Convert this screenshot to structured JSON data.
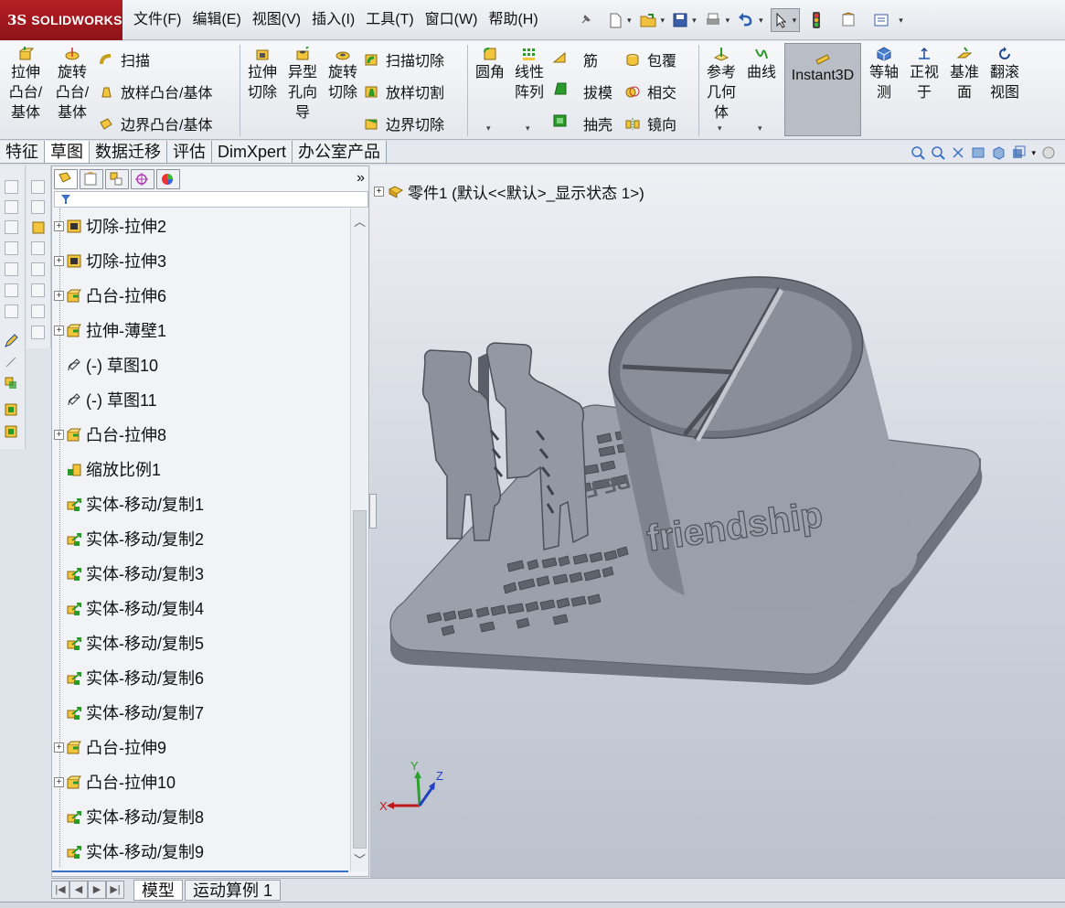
{
  "app": {
    "logo_mark": "3S",
    "logo_text": "SOLIDWORKS"
  },
  "menu": [
    "文件(F)",
    "编辑(E)",
    "视图(V)",
    "插入(I)",
    "工具(T)",
    "窗口(W)",
    "帮助(H)"
  ],
  "toolbar": {
    "extrude_boss": "拉伸\n凸台/\n基体",
    "revolve_boss": "旋转\n凸台/\n基体",
    "sweep": "扫描",
    "loft_boss": "放样凸台/基体",
    "boundary_boss": "边界凸台/基体",
    "extrude_cut": "拉伸\n切除",
    "hole_wizard": "异型\n孔向\n导",
    "revolve_cut": "旋转\n切除",
    "swept_cut": "扫描切除",
    "lofted_cut": "放样切割",
    "boundary_cut": "边界切除",
    "fillet": "圆角",
    "linear_pattern": "线性\n阵列",
    "rib": "筋",
    "draft": "拔模",
    "shell": "抽壳",
    "wrap": "包覆",
    "intersect": "相交",
    "mirror": "镜向",
    "ref_geometry": "参考\n几何\n体",
    "curves": "曲线",
    "instant3d": "Instant3D",
    "isometric": "等轴\n测",
    "normal_to": "正视\n于",
    "datum_plane": "基准\n面",
    "rollback_view": "翻滚\n视图"
  },
  "tabs": [
    "特征",
    "草图",
    "数据迁移",
    "评估",
    "DimXpert",
    "办公室产品"
  ],
  "tree": {
    "part_label": "零件1  (默认<<默认>_显示状态 1>)",
    "items": [
      {
        "label": "切除-拉伸2",
        "icon": "cut-extrude-icon",
        "expandable": true
      },
      {
        "label": "切除-拉伸3",
        "icon": "cut-extrude-icon",
        "expandable": true
      },
      {
        "label": "凸台-拉伸6",
        "icon": "boss-extrude-icon",
        "expandable": true
      },
      {
        "label": "拉伸-薄壁1",
        "icon": "thin-extrude-icon",
        "expandable": true
      },
      {
        "label": "(-) 草图10",
        "icon": "sketch-icon",
        "expandable": false
      },
      {
        "label": "(-) 草图11",
        "icon": "sketch-icon",
        "expandable": false
      },
      {
        "label": "凸台-拉伸8",
        "icon": "boss-extrude-icon",
        "expandable": true
      },
      {
        "label": "缩放比例1",
        "icon": "scale-icon",
        "expandable": false
      },
      {
        "label": "实体-移动/复制1",
        "icon": "move-copy-icon",
        "expandable": false
      },
      {
        "label": "实体-移动/复制2",
        "icon": "move-copy-icon",
        "expandable": false
      },
      {
        "label": "实体-移动/复制3",
        "icon": "move-copy-icon",
        "expandable": false
      },
      {
        "label": "实体-移动/复制4",
        "icon": "move-copy-icon",
        "expandable": false
      },
      {
        "label": "实体-移动/复制5",
        "icon": "move-copy-icon",
        "expandable": false
      },
      {
        "label": "实体-移动/复制6",
        "icon": "move-copy-icon",
        "expandable": false
      },
      {
        "label": "实体-移动/复制7",
        "icon": "move-copy-icon",
        "expandable": false
      },
      {
        "label": "凸台-拉伸9",
        "icon": "boss-extrude-icon",
        "expandable": true
      },
      {
        "label": "凸台-拉伸10",
        "icon": "boss-extrude-icon",
        "expandable": true
      },
      {
        "label": "实体-移动/复制8",
        "icon": "move-copy-icon",
        "expandable": false
      },
      {
        "label": "实体-移动/复制9",
        "icon": "move-copy-icon",
        "expandable": false
      }
    ]
  },
  "model_text": "friendship",
  "model_base_text": "ARE FR",
  "triad": {
    "x": "X",
    "y": "Y",
    "z": "Z"
  },
  "bottom_tabs": [
    "模型",
    "运动算例 1"
  ],
  "colors": {
    "accent_red": "#b51f25",
    "model_gray": "#8d919c",
    "axis_x": "#c0191c",
    "axis_y": "#2ca02c",
    "axis_z": "#2040c0"
  }
}
